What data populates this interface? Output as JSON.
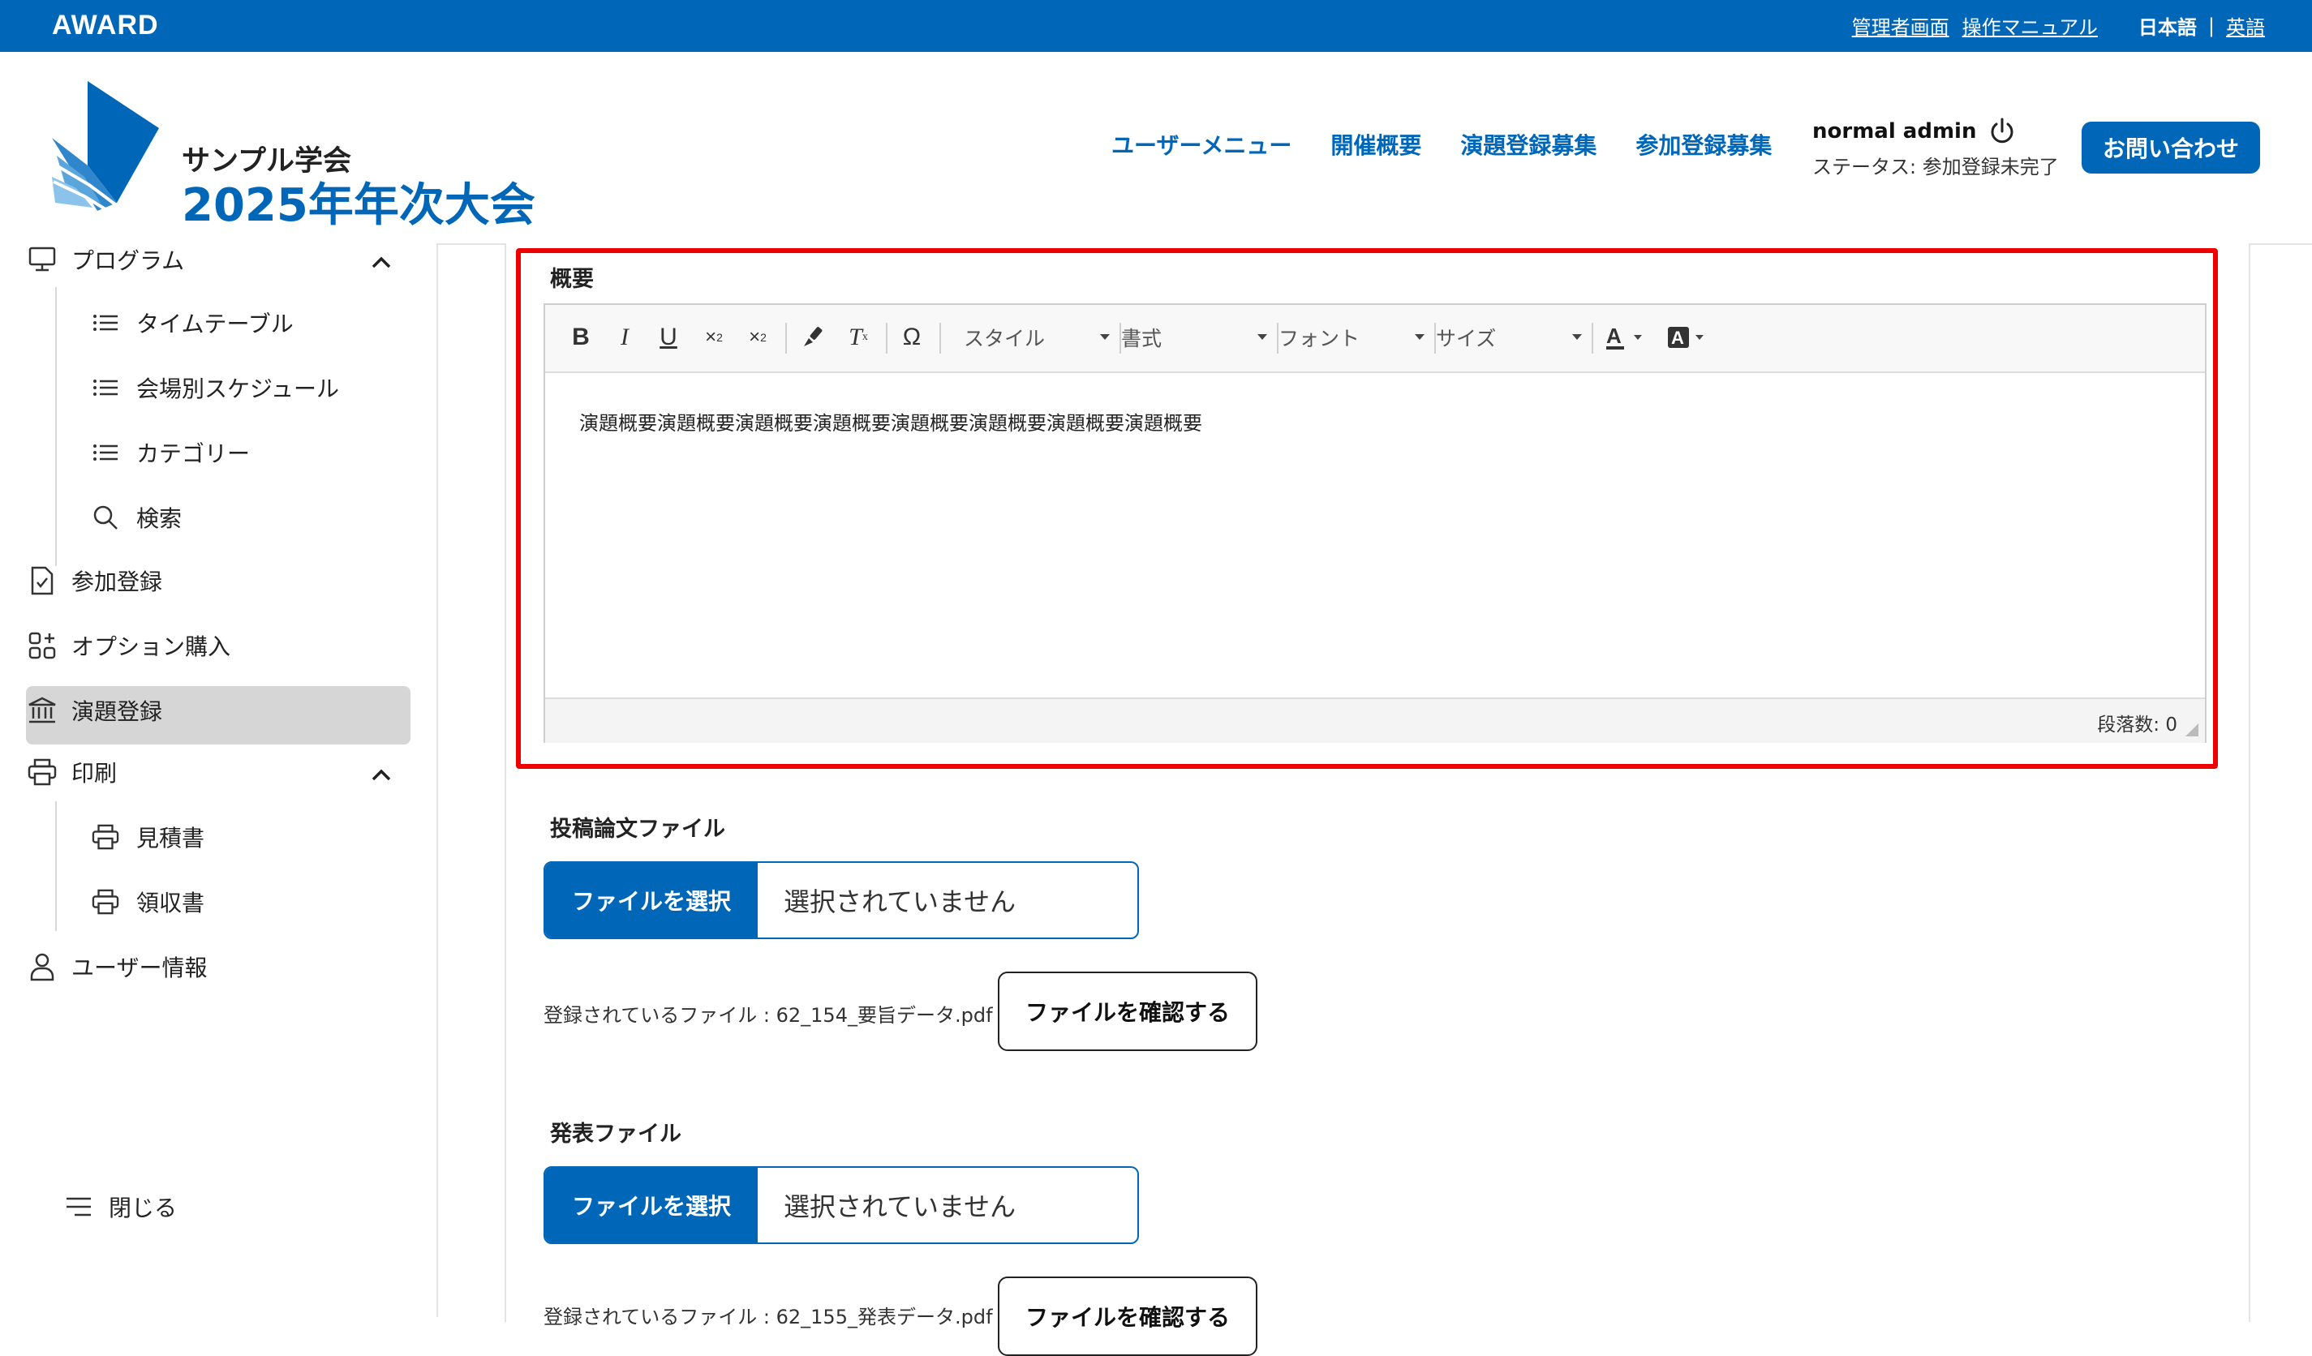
{
  "topbar": {
    "logo": "AWARD",
    "admin_link": "管理者画面",
    "manual_link": "操作マニュアル",
    "lang_current": "日本語",
    "lang_separator": "|",
    "lang_other": "英語"
  },
  "header": {
    "society": "サンプル学会",
    "event_title": "2025年年次大会",
    "nav": [
      "ユーザーメニュー",
      "開催概要",
      "演題登録募集",
      "参加登録募集"
    ],
    "user_name": "normal admin",
    "user_status": "ステータス: 参加登録未完了",
    "contact_button": "お問い合わせ"
  },
  "sidebar": {
    "program": "プログラム",
    "program_children": [
      "タイムテーブル",
      "会場別スケジュール",
      "カテゴリー",
      "検索"
    ],
    "participation": "参加登録",
    "options": "オプション購入",
    "abstract": "演題登録",
    "print": "印刷",
    "print_children": [
      "見積書",
      "領収書"
    ],
    "user_info": "ユーザー情報",
    "close": "閉じる"
  },
  "form": {
    "summary_label": "概要",
    "editor": {
      "style_label": "スタイル",
      "format_label": "書式",
      "font_label": "フォント",
      "size_label": "サイズ",
      "content": "演題概要演題概要演題概要演題概要演題概要演題概要演題概要演題概要",
      "paragraph_count": "段落数: 0"
    },
    "paper_file_label": "投稿論文ファイル",
    "choose_file_button": "ファイルを選択",
    "no_file_selected": "選択されていません",
    "paper_registered": "登録されているファイル : 62_154_要旨データ.pdf",
    "confirm_button": "ファイルを確認する",
    "presentation_file_label": "発表ファイル",
    "presentation_registered": "登録されているファイル : 62_155_発表データ.pdf"
  },
  "colors": {
    "brand_blue": "#0067b8",
    "highlight_red": "#ee0000",
    "active_bg": "#d6d6d6"
  },
  "icons": [
    "power-icon",
    "monitor-icon",
    "chevron-up-icon",
    "list-icon",
    "search-icon",
    "document-check-icon",
    "apps-icon",
    "bank-icon",
    "printer-icon",
    "user-icon",
    "menu-icon"
  ]
}
